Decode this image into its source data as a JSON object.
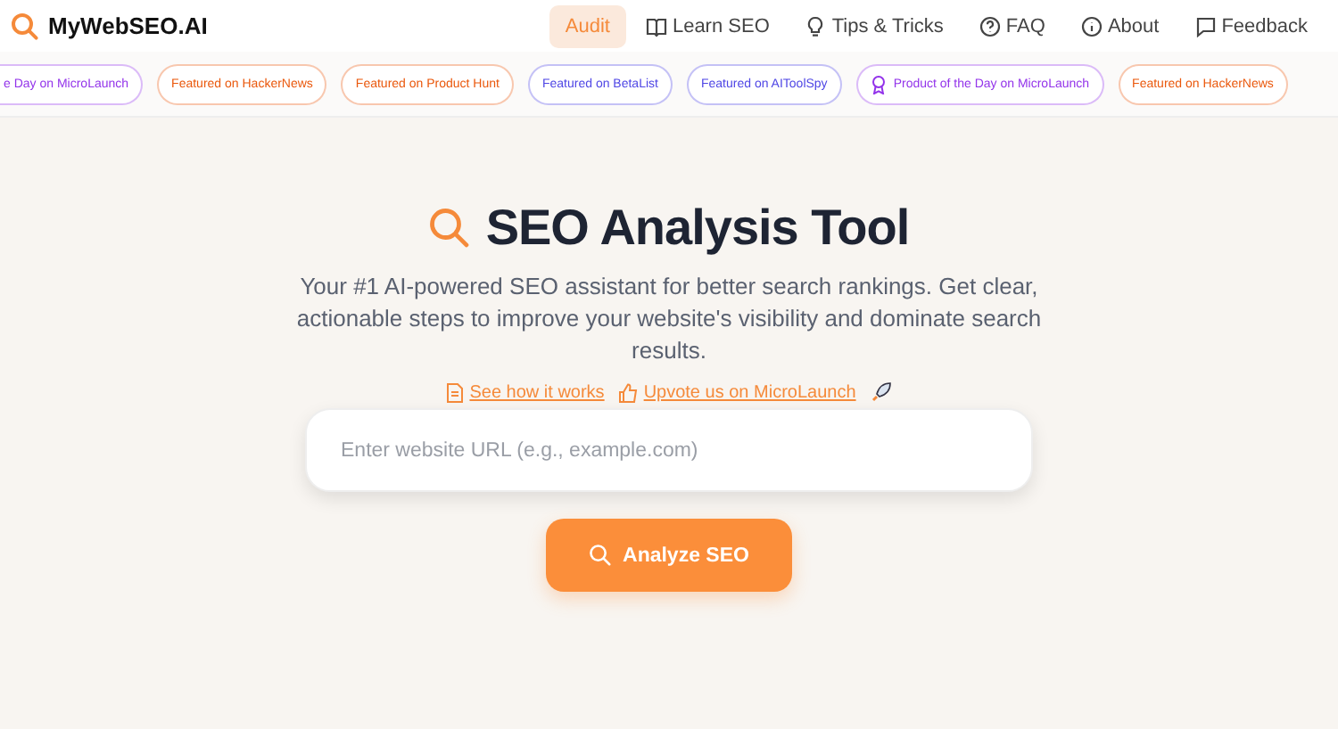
{
  "brand": {
    "name": "MyWebSEO.AI"
  },
  "nav": [
    {
      "label": "Audit",
      "kind": "plain",
      "selected": true
    },
    {
      "label": "Learn SEO",
      "kind": "book",
      "selected": false
    },
    {
      "label": "Tips & Tricks",
      "kind": "bulb",
      "selected": false
    },
    {
      "label": "FAQ",
      "kind": "question",
      "selected": false
    },
    {
      "label": "About",
      "kind": "info",
      "selected": false
    },
    {
      "label": "Feedback",
      "kind": "chat",
      "selected": false
    }
  ],
  "badges": [
    {
      "label": "e Day on MicroLaunch",
      "kind": "plain",
      "color": "#9333ea"
    },
    {
      "label": "Featured on HackerNews",
      "kind": "plain",
      "color": "#ea580c"
    },
    {
      "label": "Featured on Product Hunt",
      "kind": "plain",
      "color": "#ea580c"
    },
    {
      "label": "Featured on BetaList",
      "kind": "plain",
      "color": "#4f46e5"
    },
    {
      "label": "Featured on AIToolSpy",
      "kind": "plain",
      "color": "#4f46e5"
    },
    {
      "label": "Product of the Day on MicroLaunch",
      "kind": "award",
      "color": "#9333ea"
    },
    {
      "label": "Featured on HackerNews",
      "kind": "plain",
      "color": "#ea580c"
    }
  ],
  "hero": {
    "title": "SEO Analysis Tool",
    "subtitle": "Your #1 AI-powered SEO assistant for better search rankings. Get clear, actionable steps to improve your website's visibility and dominate search results.",
    "links": [
      {
        "label": "See how it works",
        "kind": "document"
      },
      {
        "label": "Upvote us on MicroLaunch",
        "kind": "thumb"
      }
    ],
    "search": {
      "placeholder": "Enter website URL (e.g., example.com)"
    },
    "button": "Analyze SEO"
  }
}
